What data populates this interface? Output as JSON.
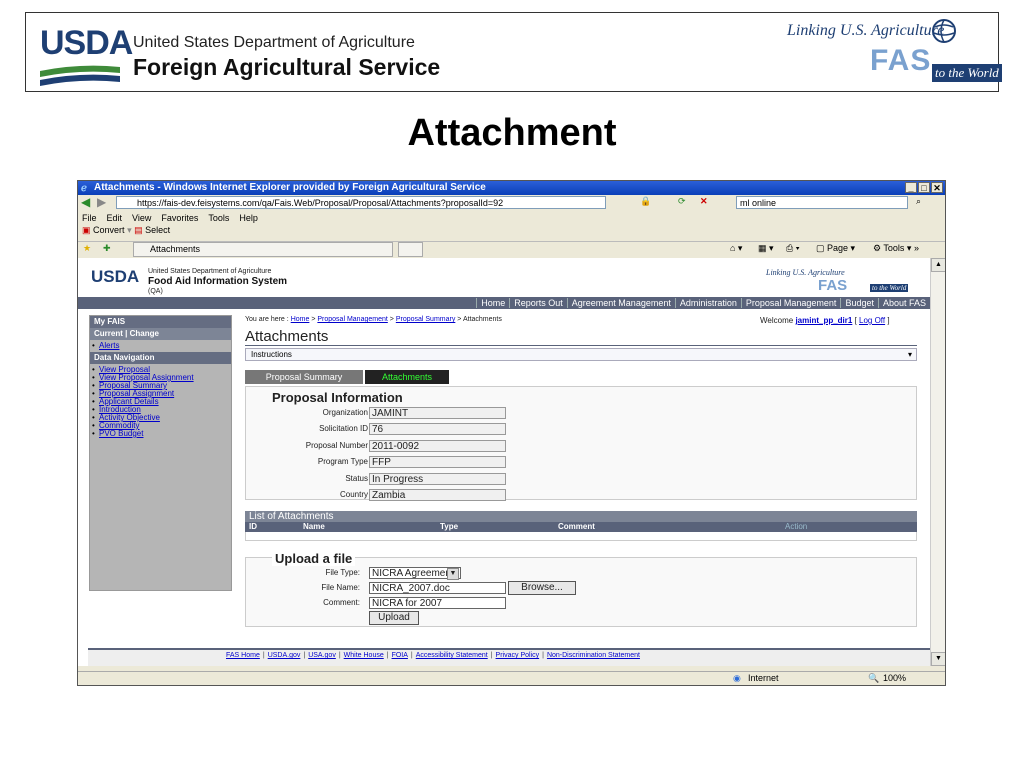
{
  "slide": {
    "org_logo": "USDA",
    "dept": "United States Department of Agriculture",
    "agency": "Foreign Agricultural Service",
    "tagline": "Linking U.S. Agriculture",
    "fas_logo": "FAS",
    "tagline2": "to the World",
    "title": "Attachment"
  },
  "browser": {
    "window_title": "Attachments - Windows Internet Explorer provided by Foreign Agricultural Service",
    "url": "https://fais-dev.feisystems.com/qa/Fais.Web/Proposal/Proposal/Attachments?proposalId=92",
    "search_value": "ml online",
    "menu": [
      "File",
      "Edit",
      "View",
      "Favorites",
      "Tools",
      "Help"
    ],
    "convert_label": "Convert",
    "select_label": "Select",
    "tab_title": "Attachments",
    "page_menu": "Page",
    "tools_menu": "Tools",
    "status_zone": "Internet",
    "zoom": "100%"
  },
  "app": {
    "logo": "USDA",
    "dept": "United States Department of Agriculture",
    "system_name": "Food Aid Information System",
    "env": "(QA)",
    "tagline": "Linking U.S. Agriculture",
    "fas_logo": "FAS",
    "tagline2": "to the World",
    "nav": [
      "Home",
      "Reports Out",
      "Agreement Management",
      "Administration",
      "Proposal Management",
      "Budget",
      "About FAS"
    ],
    "sidebar": {
      "my_fais": "My FAIS",
      "current_change": "Current | Change",
      "alerts": "Alerts",
      "data_navigation": "Data Navigation",
      "links": [
        "View Proposal",
        "View Proposal Assignment",
        "Proposal Summary",
        "Proposal Assignment",
        "Applicant Details",
        "Introduction",
        "Activity Objective",
        "Commodity",
        "PVO Budget"
      ]
    },
    "breadcrumb": {
      "prefix": "You are here :",
      "home": "Home",
      "proposal_management": "Proposal Management",
      "proposal_summary": "Proposal Summary",
      "current": "Attachments",
      "sep": ">"
    },
    "welcome": {
      "text": "Welcome",
      "user": "jamint_pp_dir1",
      "logoff": "Log Off"
    },
    "page_title": "Attachments",
    "instructions_label": "Instructions",
    "tabs": [
      "Proposal Summary",
      "Attachments"
    ],
    "proposal_info": {
      "heading": "Proposal Information",
      "fields": [
        {
          "label": "Organization",
          "value": "JAMINT"
        },
        {
          "label": "Solicitation ID",
          "value": "76"
        },
        {
          "label": "Proposal Number",
          "value": "2011-0092"
        },
        {
          "label": "Program Type",
          "value": "FFP"
        },
        {
          "label": "Status",
          "value": "In Progress"
        },
        {
          "label": "Country",
          "value": "Zambia"
        }
      ]
    },
    "attachments_list": {
      "heading": "List of Attachments",
      "columns": [
        "ID",
        "Name",
        "Type",
        "Comment",
        "Action"
      ]
    },
    "upload": {
      "heading": "Upload a file",
      "file_type_label": "File Type:",
      "file_type_value": "NICRA Agreement",
      "file_name_label": "File Name:",
      "file_name_value": "NICRA_2007.doc",
      "browse_label": "Browse...",
      "comment_label": "Comment:",
      "comment_value": "NICRA for 2007",
      "upload_label": "Upload"
    },
    "footer_links": [
      "FAS Home",
      "USDA.gov",
      "USA.gov",
      "White House",
      "FOIA",
      "Accessibility Statement",
      "Privacy Policy",
      "Non-Discrimination Statement"
    ]
  }
}
